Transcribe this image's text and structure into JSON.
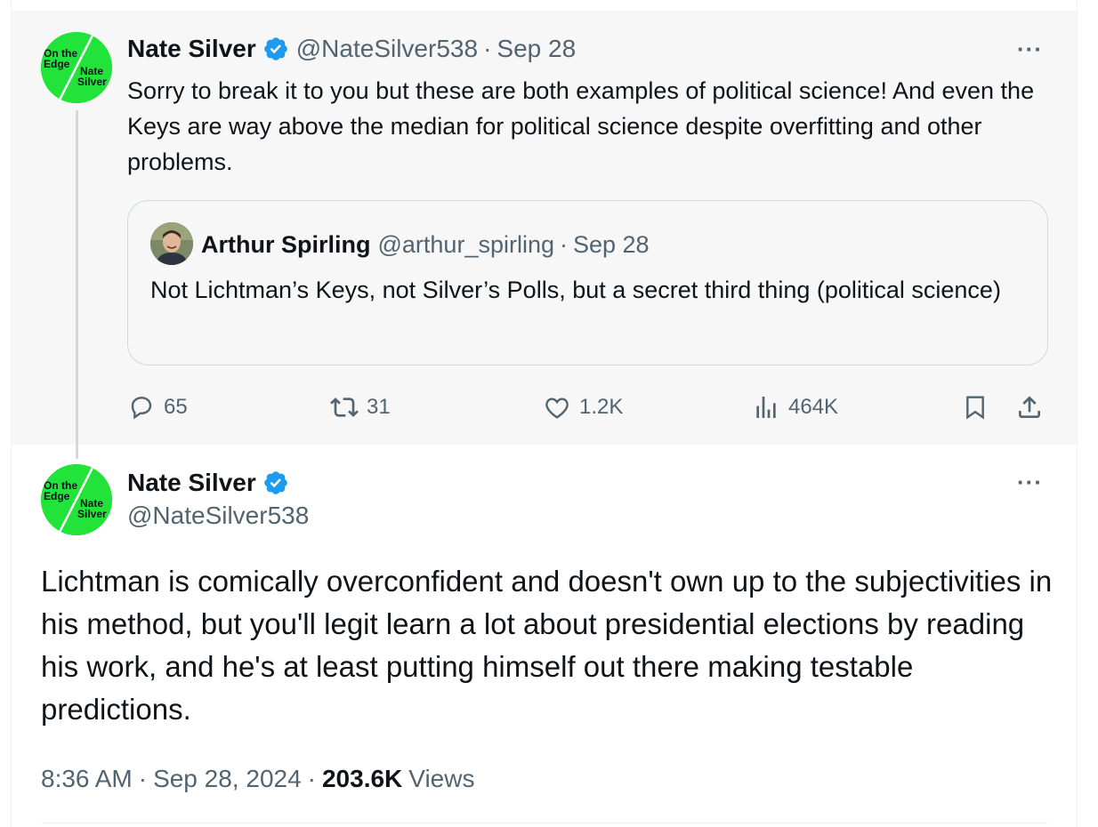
{
  "parent_tweet": {
    "author_name": "Nate Silver",
    "handle": "@NateSilver538",
    "separator": "·",
    "date": "Sep 28",
    "more_label": "···",
    "text": "Sorry to break it to you but these are both examples of political science! And even the Keys are way above the median for political science despite overfitting and other problems.",
    "quote": {
      "author_name": "Arthur Spirling",
      "handle": "@arthur_spirling",
      "separator": "·",
      "date": "Sep 28",
      "text": "Not Lichtman’s Keys, not Silver’s Polls, but a secret third thing (political science)"
    },
    "actions": {
      "replies": "65",
      "reposts": "31",
      "likes": "1.2K",
      "views": "464K"
    },
    "action_icons": [
      "reply-icon",
      "repost-icon",
      "like-icon",
      "views-icon",
      "bookmark-icon",
      "share-icon"
    ]
  },
  "main_tweet": {
    "author_name": "Nate Silver",
    "handle": "@NateSilver538",
    "more_label": "···",
    "text": "Lichtman is comically overconfident and doesn't own up to the subjectivities in his method, but you'll legit learn a lot about presidential elections by reading his work, and he's at least putting himself out there making testable predictions.",
    "time": "8:36 AM",
    "separator": "·",
    "date": "Sep 28, 2024",
    "views_count": "203.6K",
    "views_label": "Views"
  },
  "avatar_art": {
    "line1": "On the",
    "line2": "Edge",
    "line3": "Nate",
    "line4": "Silver"
  },
  "colors": {
    "verified_blue": "#1d9bf0",
    "avatar_green": "#22e33a",
    "muted_text": "#536471",
    "primary_text": "#0f1419",
    "parent_background": "#f7f7f7",
    "border": "#cfd9de"
  }
}
